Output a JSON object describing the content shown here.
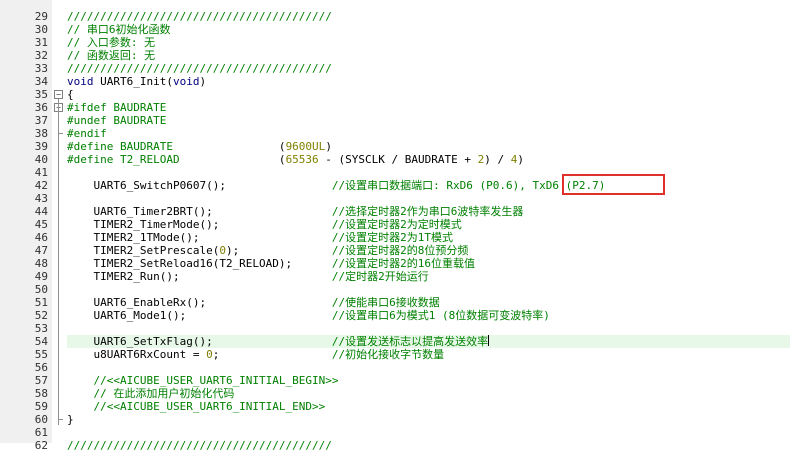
{
  "editor": {
    "lines": [
      {
        "n": "29",
        "text": "////////////////////////////////////////",
        "kind": "comment"
      },
      {
        "n": "30",
        "text": "// 串口6初始化函数",
        "kind": "comment"
      },
      {
        "n": "31",
        "text": "// 入口参数: 无",
        "kind": "comment"
      },
      {
        "n": "32",
        "text": "// 函数返回: 无",
        "kind": "comment"
      },
      {
        "n": "33",
        "text": "////////////////////////////////////////",
        "kind": "comment"
      },
      {
        "n": "34",
        "text": "void UART6_Init(void)",
        "kind": "code"
      },
      {
        "n": "35",
        "text": "{",
        "kind": "code"
      },
      {
        "n": "36",
        "text": "#ifdef BAUDRATE",
        "kind": "pp"
      },
      {
        "n": "37",
        "text": "#undef BAUDRATE",
        "kind": "pp"
      },
      {
        "n": "38",
        "text": "#endif",
        "kind": "pp"
      },
      {
        "n": "39",
        "text": "#define BAUDRATE                (9600UL)",
        "kind": "pp"
      },
      {
        "n": "40",
        "text": "#define T2_RELOAD               (65536 - (SYSCLK / BAUDRATE + 2) / 4)",
        "kind": "pp"
      },
      {
        "n": "41",
        "text": "",
        "kind": "code"
      },
      {
        "n": "42",
        "text": "    UART6_SwitchP0607();                //设置串口数据端口: RxD6 (P0.6), TxD6 (P2.7)",
        "kind": "code"
      },
      {
        "n": "43",
        "text": "",
        "kind": "code"
      },
      {
        "n": "44",
        "text": "    UART6_Timer2BRT();                  //选择定时器2作为串口6波特率发生器",
        "kind": "code"
      },
      {
        "n": "45",
        "text": "    TIMER2_TimerMode();                 //设置定时器2为定时模式",
        "kind": "code"
      },
      {
        "n": "46",
        "text": "    TIMER2_1TMode();                    //设置定时器2为1T模式",
        "kind": "code"
      },
      {
        "n": "47",
        "text": "    TIMER2_SetPrescale(0);              //设置定时器2的8位预分频",
        "kind": "code"
      },
      {
        "n": "48",
        "text": "    TIMER2_SetReload16(T2_RELOAD);      //设置定时器2的16位重载值",
        "kind": "code"
      },
      {
        "n": "49",
        "text": "    TIMER2_Run();                       //定时器2开始运行",
        "kind": "code"
      },
      {
        "n": "50",
        "text": "",
        "kind": "code"
      },
      {
        "n": "51",
        "text": "    UART6_EnableRx();                   //使能串口6接收数据",
        "kind": "code"
      },
      {
        "n": "52",
        "text": "    UART6_Mode1();                      //设置串口6为模式1 (8位数据可变波特率)",
        "kind": "code"
      },
      {
        "n": "53",
        "text": "",
        "kind": "code"
      },
      {
        "n": "54",
        "text": "    UART6_SetTxFlag();                  //设置发送标志以提高发送效率",
        "kind": "code"
      },
      {
        "n": "55",
        "text": "    u8UART6RxCount = 0;                 //初始化接收字节数量",
        "kind": "code"
      },
      {
        "n": "56",
        "text": "",
        "kind": "code"
      },
      {
        "n": "57",
        "text": "    //<<AICUBE_USER_UART6_INITIAL_BEGIN>>",
        "kind": "comment"
      },
      {
        "n": "58",
        "text": "    // 在此添加用户初始化代码",
        "kind": "comment"
      },
      {
        "n": "59",
        "text": "    //<<AICUBE_USER_UART6_INITIAL_END>>",
        "kind": "comment"
      },
      {
        "n": "60",
        "text": "}",
        "kind": "code"
      },
      {
        "n": "61",
        "text": "",
        "kind": "code"
      },
      {
        "n": "62",
        "text": "////////////////////////////////////////",
        "kind": "comment"
      }
    ],
    "current_line": "54",
    "highlighted_text": "TxD6 (P2.7)"
  },
  "colors": {
    "comment": "#008000",
    "preprocessor": "#008000",
    "number": "#808000",
    "keyword": "#000080",
    "current_line_bg": "#e8f8e8",
    "highlight_border": "#e0302c"
  }
}
